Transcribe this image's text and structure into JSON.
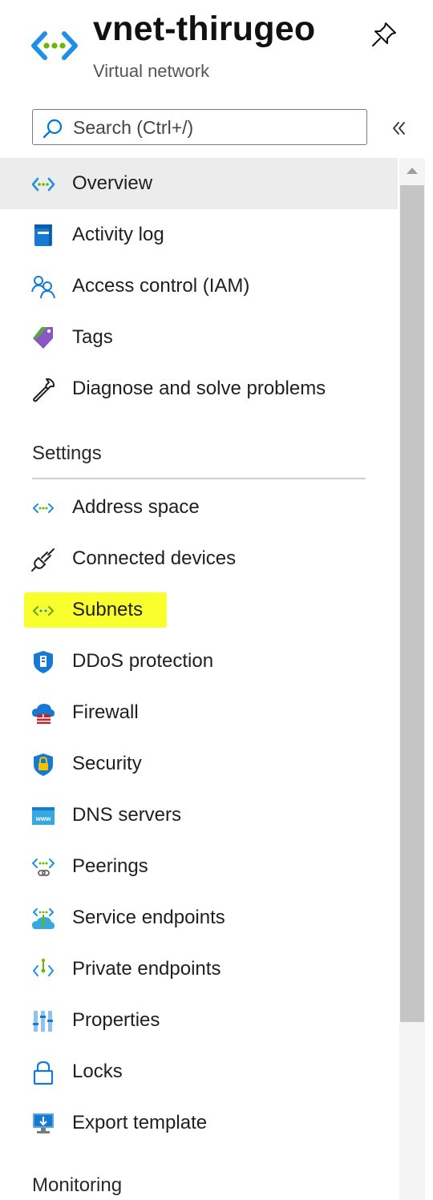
{
  "header": {
    "title": "vnet-thirugeo",
    "subtitle": "Virtual network",
    "logo_icon": "virtual-network-icon",
    "pin_icon": "pin-icon"
  },
  "search": {
    "placeholder": "Search (Ctrl+/)",
    "collapse_icon": "double-chevron-left-icon"
  },
  "menu": {
    "top_items": [
      {
        "label": "Overview",
        "icon": "virtual-network-icon",
        "selected": true
      },
      {
        "label": "Activity log",
        "icon": "activity-log-icon"
      },
      {
        "label": "Access control (IAM)",
        "icon": "people-icon"
      },
      {
        "label": "Tags",
        "icon": "tag-icon"
      },
      {
        "label": "Diagnose and solve problems",
        "icon": "wrench-icon"
      }
    ],
    "settings_title": "Settings",
    "settings_items": [
      {
        "label": "Address space",
        "icon": "address-space-icon"
      },
      {
        "label": "Connected devices",
        "icon": "plug-icon"
      },
      {
        "label": "Subnets",
        "icon": "subnet-icon",
        "highlighted": true
      },
      {
        "label": "DDoS protection",
        "icon": "ddos-shield-icon"
      },
      {
        "label": "Firewall",
        "icon": "firewall-icon"
      },
      {
        "label": "Security",
        "icon": "security-shield-icon"
      },
      {
        "label": "DNS servers",
        "icon": "dns-icon"
      },
      {
        "label": "Peerings",
        "icon": "peering-icon"
      },
      {
        "label": "Service endpoints",
        "icon": "service-endpoint-icon"
      },
      {
        "label": "Private endpoints",
        "icon": "private-endpoint-icon"
      },
      {
        "label": "Properties",
        "icon": "properties-icon"
      },
      {
        "label": "Locks",
        "icon": "lock-icon"
      },
      {
        "label": "Export template",
        "icon": "export-template-icon"
      }
    ],
    "monitoring_title": "Monitoring"
  },
  "colors": {
    "accent_blue": "#0078d4",
    "green_dot": "#6bb700",
    "selected_bg": "#ececec",
    "highlight": "#f8ff2c"
  }
}
